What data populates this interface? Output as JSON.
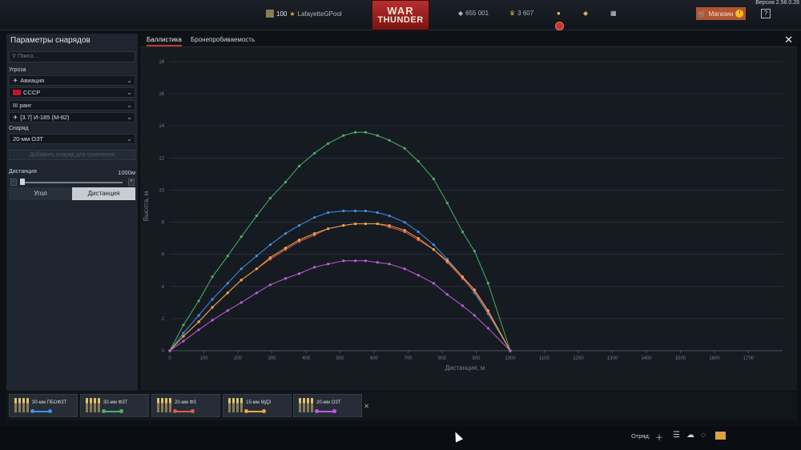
{
  "topbar": {
    "version": "Версия 2.58.0.28",
    "level": "100",
    "username": "LafayetteGPool",
    "silver": "655 001",
    "gold": "3 607",
    "logo_line1": "WAR",
    "logo_line2": "THUNDER",
    "shop_label": "Магазин"
  },
  "panel": {
    "title": "Параметры снарядов",
    "search_placeholder": "Поиск...",
    "threat_label": "Угроза",
    "threat_value": "Авиация",
    "country_value": "СССР",
    "rank_value": "III ранг",
    "vehicle_value": "[3.7] И-185 (М-82)",
    "shell_label": "Снаряд",
    "shell_value": "20-мм ОЗТ",
    "add_button": "Добавить снаряд для сравнения",
    "distance_label": "Дистанция",
    "distance_value": "1000м",
    "slider_minus": "-",
    "slider_plus": "+",
    "angle_button": "Угол",
    "distance_button": "Дистанция"
  },
  "tabs": {
    "ballistics": "Баллистика",
    "penetration": "Бронепробиваемость"
  },
  "chart_data": {
    "type": "line",
    "xlabel": "Дистанция, м",
    "ylabel": "Высота, м",
    "xlim": [
      0,
      1800
    ],
    "ylim": [
      0,
      18
    ],
    "xticks": [
      0,
      100,
      200,
      300,
      400,
      500,
      600,
      700,
      800,
      900,
      1000,
      1100,
      1200,
      1300,
      1400,
      1500,
      1600,
      1700
    ],
    "yticks": [
      0,
      2,
      4,
      6,
      8,
      10,
      12,
      14,
      16,
      18
    ],
    "grid": true,
    "series": [
      {
        "color": "#4caf6a",
        "x": [
          0,
          40,
          85,
          125,
          170,
          210,
          255,
          295,
          340,
          380,
          425,
          465,
          510,
          545,
          575,
          610,
          645,
          690,
          730,
          775,
          815,
          860,
          895,
          935,
          1000
        ],
        "y": [
          0,
          1.6,
          3.1,
          4.6,
          5.9,
          7.1,
          8.4,
          9.5,
          10.5,
          11.5,
          12.3,
          12.9,
          13.4,
          13.6,
          13.6,
          13.4,
          13.1,
          12.6,
          11.8,
          10.7,
          9.2,
          7.4,
          6.2,
          4.2,
          0
        ]
      },
      {
        "color": "#3f8fe6",
        "x": [
          0,
          40,
          85,
          125,
          170,
          210,
          255,
          295,
          340,
          380,
          425,
          465,
          510,
          545,
          575,
          610,
          645,
          690,
          730,
          775,
          815,
          860,
          895,
          935,
          1000
        ],
        "y": [
          0,
          1.1,
          2.2,
          3.2,
          4.2,
          5.1,
          5.9,
          6.6,
          7.3,
          7.8,
          8.3,
          8.6,
          8.7,
          8.7,
          8.7,
          8.6,
          8.4,
          8.0,
          7.4,
          6.6,
          5.7,
          4.6,
          3.6,
          2.3,
          0
        ]
      },
      {
        "color": "#e05a4f",
        "x": [
          0,
          40,
          85,
          125,
          170,
          210,
          255,
          295,
          340,
          380,
          425,
          465,
          510,
          545,
          575,
          610,
          645,
          690,
          730,
          775,
          815,
          860,
          895,
          935,
          1000
        ],
        "y": [
          0,
          0.9,
          1.8,
          2.7,
          3.6,
          4.4,
          5.1,
          5.7,
          6.3,
          6.8,
          7.2,
          7.6,
          7.8,
          7.9,
          7.9,
          7.9,
          7.7,
          7.4,
          6.9,
          6.3,
          5.5,
          4.5,
          3.7,
          2.4,
          0
        ]
      },
      {
        "color": "#f0a64b",
        "x": [
          0,
          40,
          85,
          125,
          170,
          210,
          255,
          295,
          340,
          380,
          425,
          465,
          510,
          545,
          575,
          610,
          645,
          690,
          730,
          775,
          815,
          860,
          895,
          935,
          1000
        ],
        "y": [
          0,
          0.9,
          1.8,
          2.7,
          3.6,
          4.4,
          5.1,
          5.8,
          6.4,
          6.9,
          7.3,
          7.6,
          7.8,
          7.9,
          7.9,
          7.9,
          7.8,
          7.5,
          7.0,
          6.3,
          5.6,
          4.6,
          3.8,
          2.5,
          0
        ]
      },
      {
        "color": "#c05be0",
        "x": [
          0,
          40,
          85,
          125,
          170,
          210,
          255,
          295,
          340,
          380,
          425,
          465,
          510,
          545,
          575,
          610,
          645,
          690,
          730,
          775,
          815,
          860,
          895,
          935,
          1000
        ],
        "y": [
          0,
          0.6,
          1.3,
          1.9,
          2.5,
          3.0,
          3.6,
          4.1,
          4.5,
          4.8,
          5.2,
          5.4,
          5.6,
          5.6,
          5.6,
          5.5,
          5.4,
          5.1,
          4.7,
          4.2,
          3.5,
          2.8,
          2.2,
          1.4,
          0
        ]
      }
    ]
  },
  "ammo": [
    {
      "name": "30-мм ПБОФЗТ",
      "color": "#3f8fe6"
    },
    {
      "name": "30-мм ФЗТ",
      "color": "#4caf6a"
    },
    {
      "name": "20-мм ФЗ",
      "color": "#e05a4f"
    },
    {
      "name": "15-мм МДЗ",
      "color": "#f0a64b"
    },
    {
      "name": "20-мм ОЗТ",
      "color": "#c05be0"
    }
  ],
  "footer": {
    "squad_label": "Отряд:"
  }
}
